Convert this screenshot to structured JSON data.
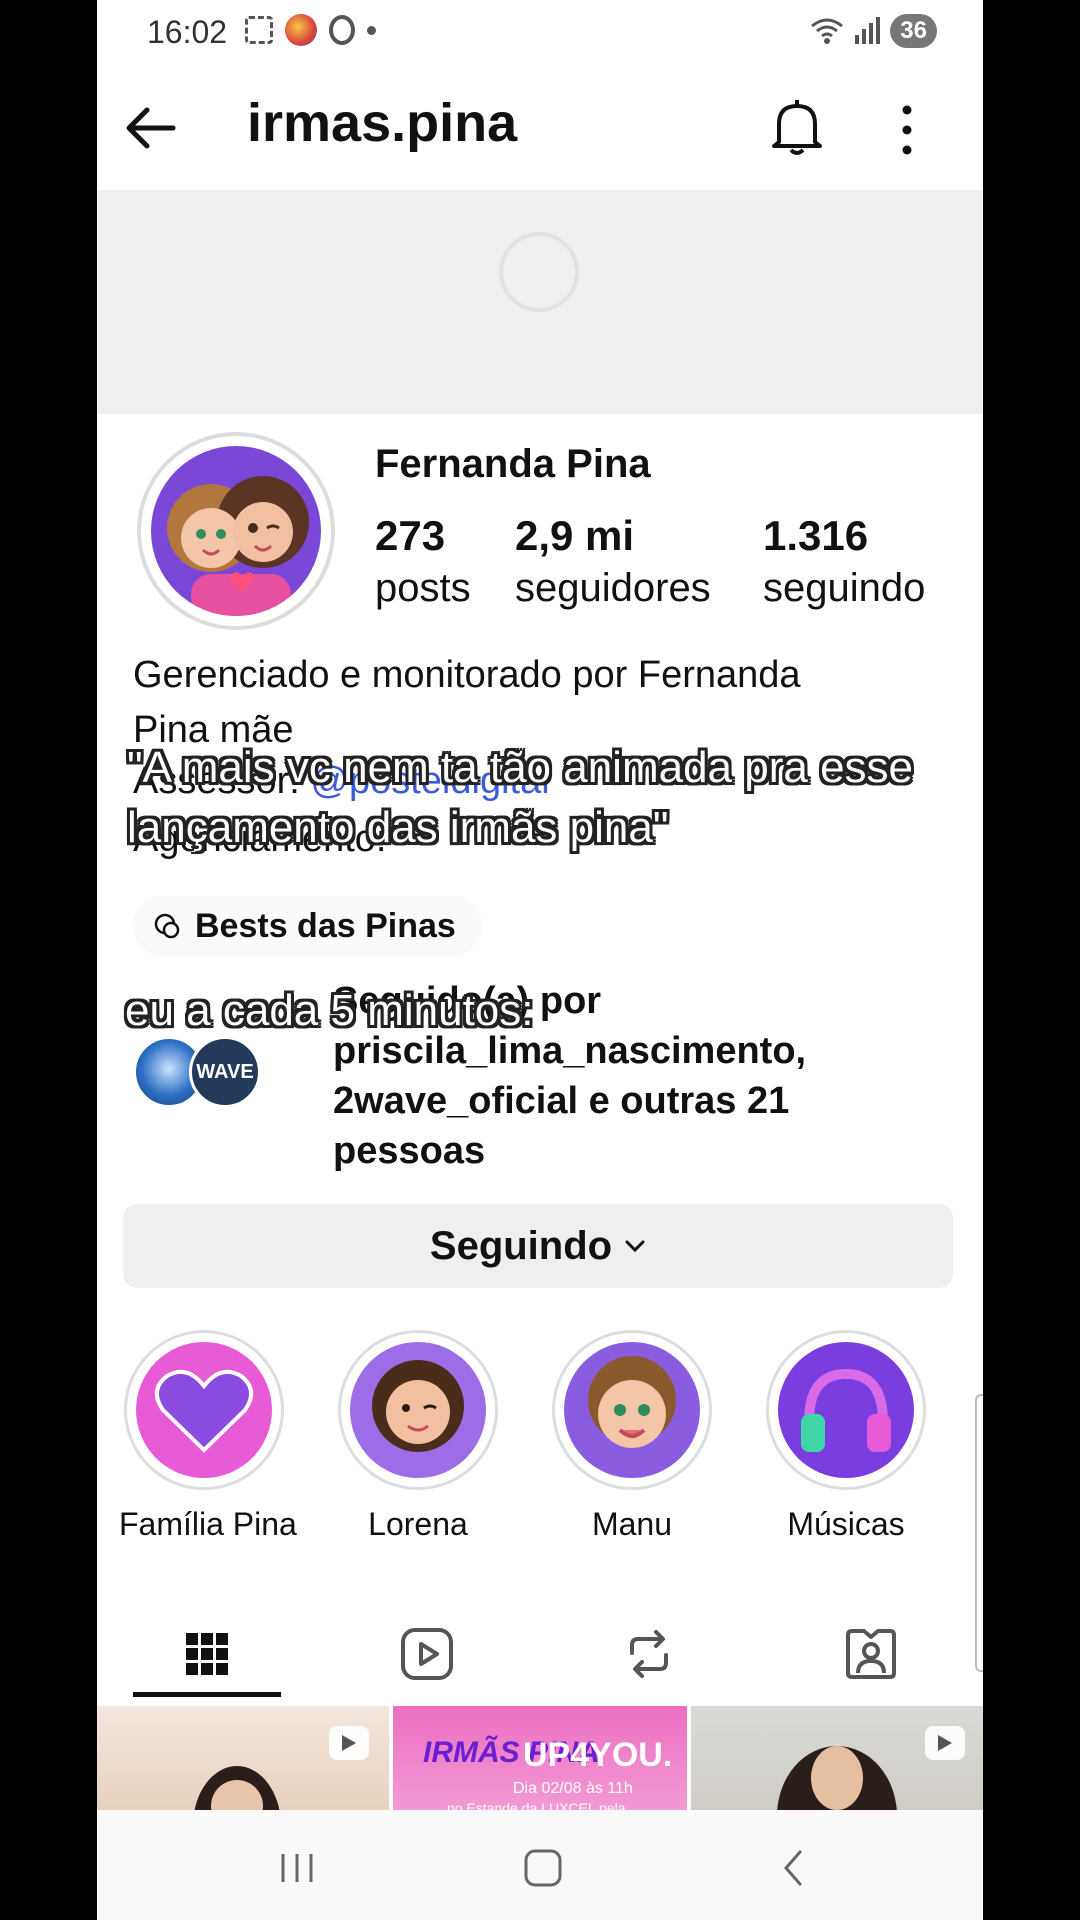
{
  "status_bar": {
    "time": "16:02",
    "battery": "36"
  },
  "header": {
    "username": "irmas.pina"
  },
  "profile": {
    "name": "Fernanda Pina",
    "stats": [
      {
        "value": "273",
        "label": "posts"
      },
      {
        "value": "2,9 mi",
        "label": "seguidores"
      },
      {
        "value": "1.316",
        "label": "seguindo"
      }
    ],
    "bio_line1": "Gerenciado e monitorado por Fernanda",
    "bio_line2": "Pina mãe",
    "bio_line3_prefix": "Assessor: ",
    "bio_line3_link": "@posteldigital",
    "bio_line4": "Agenciamento: ",
    "link_chip": "Bests das Pinas",
    "followed_by": "Seguido(a) por priscila_lima_nascimento, 2wave_oficial e outras 21 pessoas",
    "followed_avatar2": "WAVE",
    "follow_button": "Seguindo"
  },
  "overlay": {
    "caption1": "\"A mais vc nem ta tão animada pra esse lançamento das irmãs pina\"",
    "caption2": "eu a cada 5 minutos:"
  },
  "highlights": [
    {
      "label": "Família Pina",
      "color": "#e85bd6"
    },
    {
      "label": "Lorena",
      "color": "#9b6ee8"
    },
    {
      "label": "Manu",
      "color": "#8a5de0"
    },
    {
      "label": "Músicas",
      "color": "#7a3de0"
    }
  ],
  "grid": {
    "promo_brand": "IRMÃS PINA",
    "promo_title": "UP4YOU.",
    "promo_sub": "Dia 02/08 às 11h",
    "promo_sub2": "no Estande da LUXCEL pela"
  },
  "colors": {
    "accent": "#111111",
    "link": "#3b5bd9",
    "promo_pink": "#ec6ec2"
  }
}
